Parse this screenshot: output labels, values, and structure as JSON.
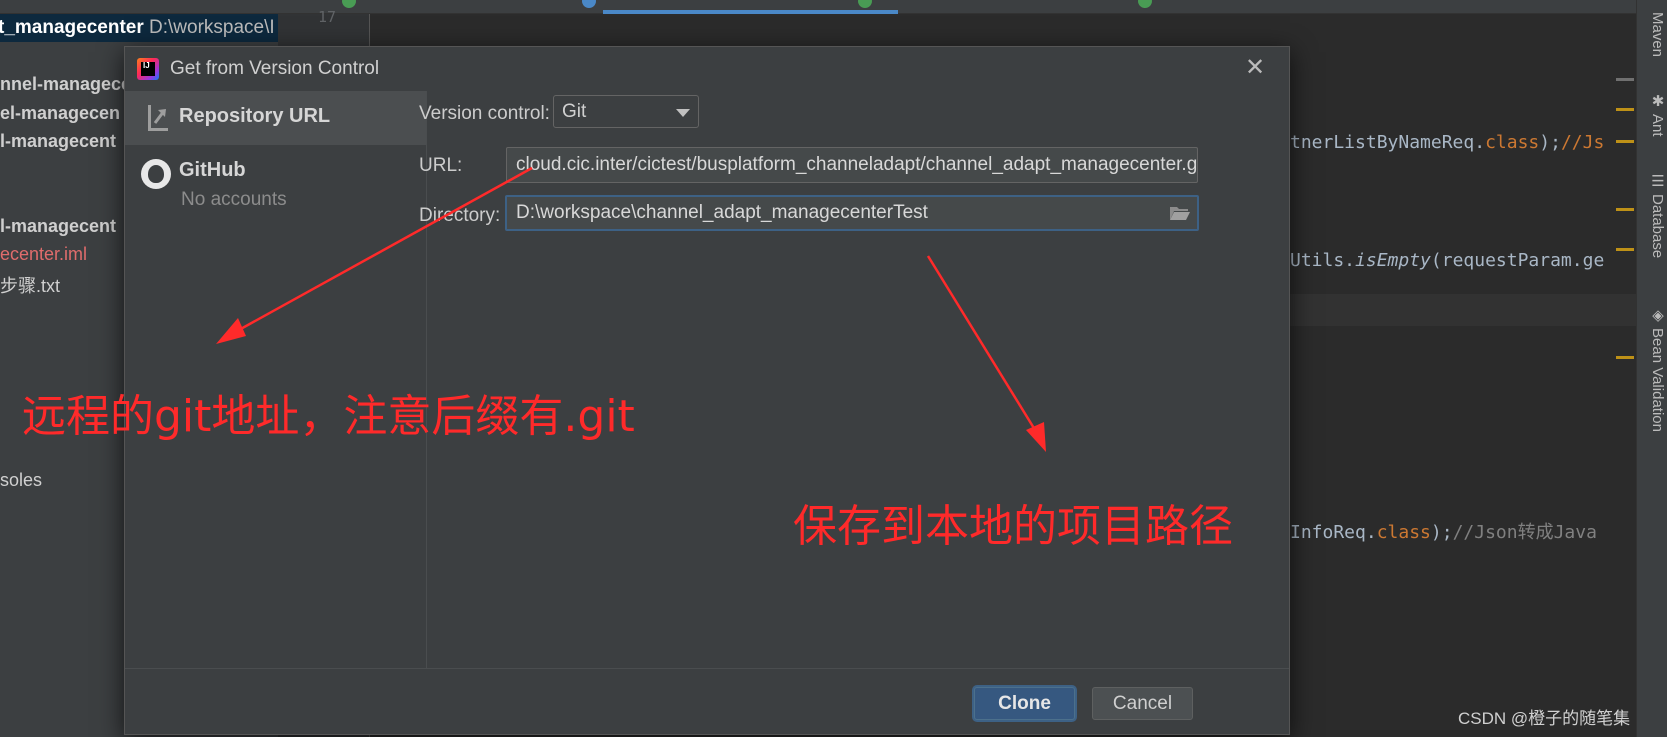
{
  "project": {
    "root_name": "t_managecenter",
    "root_path": "D:\\workspace\\I",
    "items": [
      "nnel-managece",
      "el-managecen",
      "l-managecent",
      "l-managecent",
      "ecenter.iml",
      "步骤.txt",
      "soles"
    ]
  },
  "gutter": {
    "line_number": "17"
  },
  "editor": {
    "line1": {
      "a": "tnerListByNameReq.",
      "b": "class",
      "c": ");",
      "d": "//Js"
    },
    "line2": {
      "a": "Utils.",
      "b": "isEmpty",
      "c": "(requestParam.ge"
    },
    "line3": {
      "a": "InfoReq.",
      "b": "class",
      "c": ");",
      "d": "//Json转成Java"
    }
  },
  "right_toolbar": {
    "tabs": [
      "Maven",
      "Ant",
      "Database",
      "Bean Validation"
    ]
  },
  "dialog": {
    "title": "Get from Version Control",
    "close_glyph": "✕",
    "sidebar": {
      "repository_url": "Repository URL",
      "github": "GitHub",
      "github_sub": "No accounts"
    },
    "version_control_label": "Version control:",
    "version_control_value": "Git",
    "url_label": "URL:",
    "url_value": "cloud.cic.inter/cictest/busplatform_channeladapt/channel_adapt_managecenter.git",
    "directory_label": "Directory:",
    "directory_value": "D:\\workspace\\channel_adapt_managecenterTest",
    "clone_label": "Clone",
    "cancel_label": "Cancel"
  },
  "annotations": {
    "remote_note": "远程的git地址，注意后缀有.git",
    "local_note": "保存到本地的项目路径"
  },
  "watermark": "CSDN @橙子的随笔集",
  "colors": {
    "annotation": "#ff2a2a",
    "focus_border": "#3d6185",
    "clone_button": "#365880",
    "keyword": "#cc7832"
  }
}
